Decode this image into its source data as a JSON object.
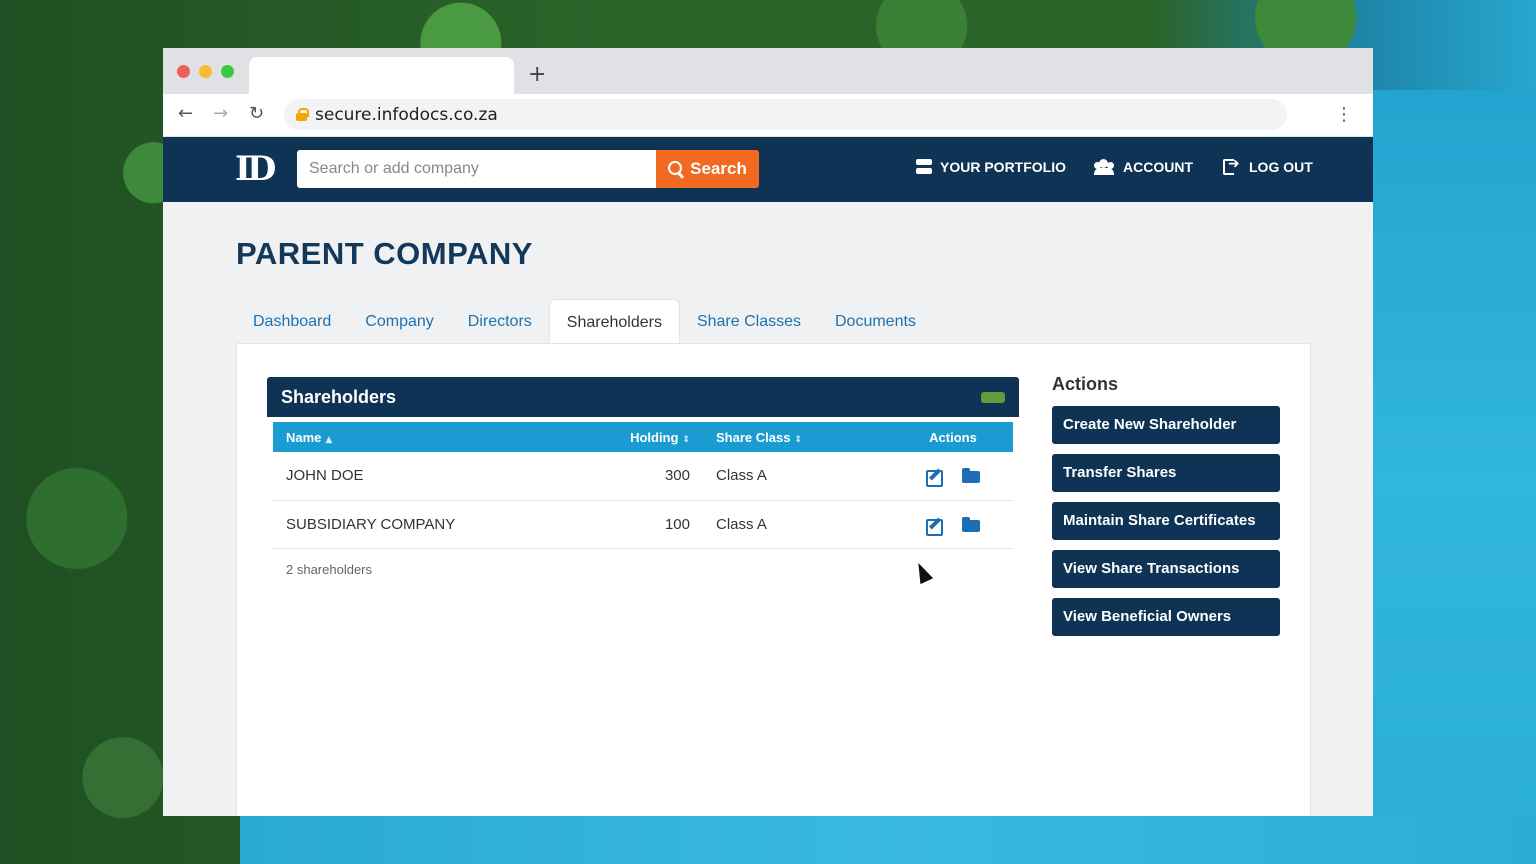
{
  "browser": {
    "url": "secure.infodocs.co.za",
    "new_tab_glyph": "+",
    "back_glyph": "←",
    "forward_glyph": "→",
    "reload_glyph": "↻",
    "menu_glyph": "⋮"
  },
  "header": {
    "logo_text": "ID",
    "search_placeholder": "Search or add company",
    "search_button": "Search",
    "nav": {
      "portfolio": "YOUR PORTFOLIO",
      "account": "ACCOUNT",
      "logout": "LOG OUT"
    },
    "colors": {
      "bar": "#0e3354",
      "search_button": "#f26a21"
    }
  },
  "page": {
    "title": "PARENT COMPANY",
    "tabs": [
      {
        "label": "Dashboard",
        "active": false
      },
      {
        "label": "Company",
        "active": false
      },
      {
        "label": "Directors",
        "active": false
      },
      {
        "label": "Shareholders",
        "active": true
      },
      {
        "label": "Share Classes",
        "active": false
      },
      {
        "label": "Documents",
        "active": false
      }
    ]
  },
  "shareholders": {
    "title": "Shareholders",
    "columns": {
      "name": "Name",
      "holding": "Holding",
      "share_class": "Share Class",
      "actions": "Actions"
    },
    "sort_asc_glyph": "▲",
    "sort_both_glyph": "⇕",
    "rows": [
      {
        "name": "JOHN DOE",
        "holding": "300",
        "share_class": "Class A"
      },
      {
        "name": "SUBSIDIARY COMPANY",
        "holding": "100",
        "share_class": "Class A"
      }
    ],
    "count_text": "2 shareholders",
    "header_color": "#1a9bd1"
  },
  "actions": {
    "title": "Actions",
    "buttons": [
      "Create New Shareholder",
      "Transfer Shares",
      "Maintain Share Certificates",
      "View Share Transactions",
      "View Beneficial Owners"
    ]
  }
}
